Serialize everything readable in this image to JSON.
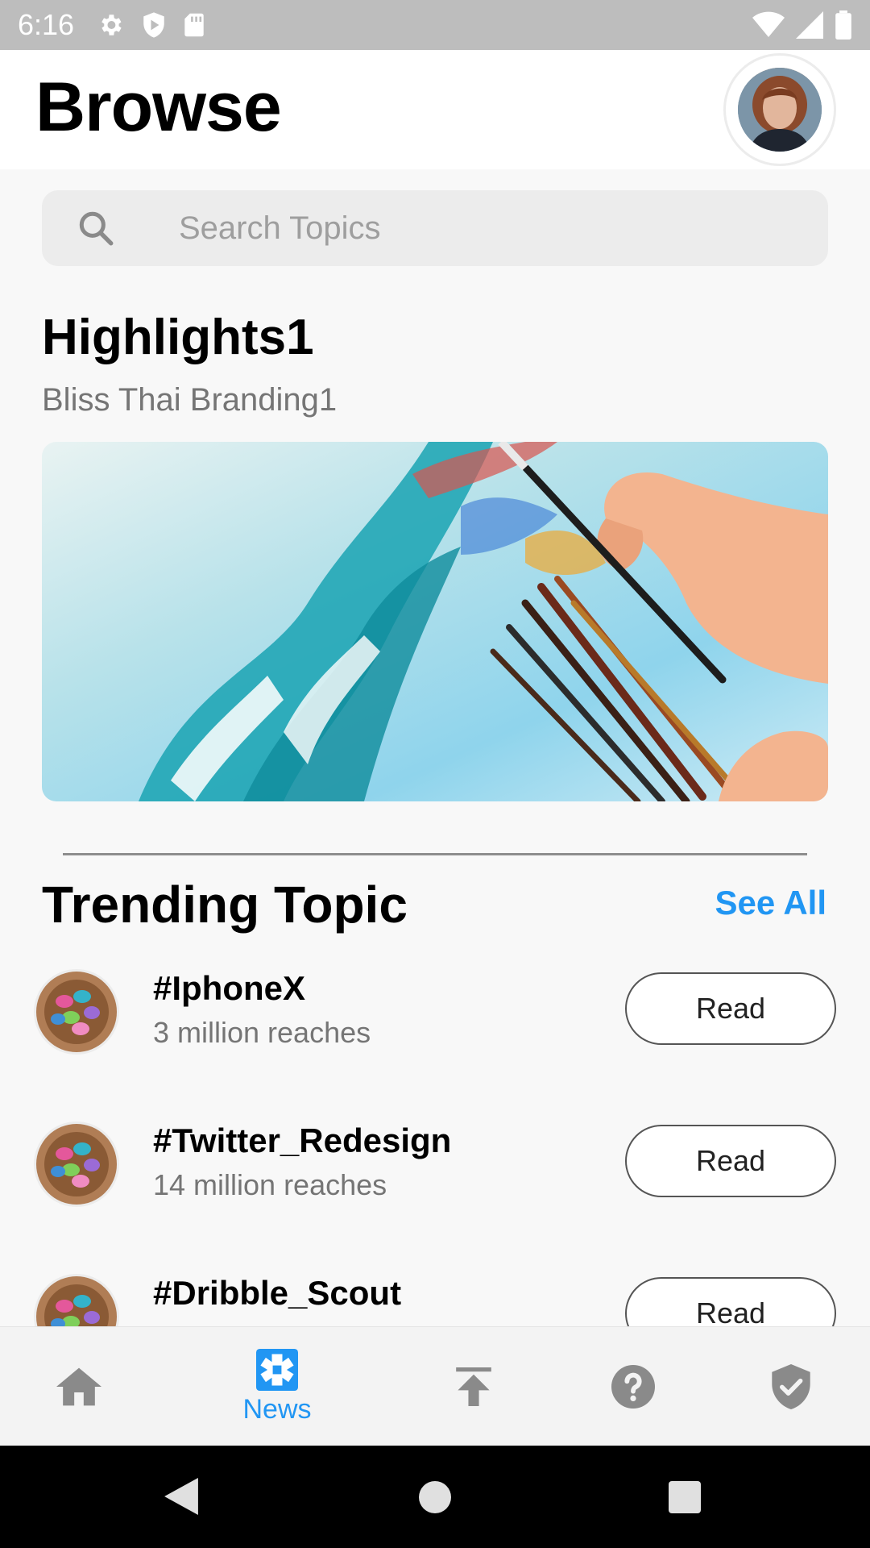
{
  "status_bar": {
    "time": "6:16"
  },
  "header": {
    "title": "Browse"
  },
  "search": {
    "placeholder": "Search Topics"
  },
  "highlights": {
    "title": "Highlights1",
    "subtitle": "Bliss Thai Branding1"
  },
  "trending": {
    "title": "Trending Topic",
    "see_all": "See All",
    "topics": [
      {
        "name": "#IphoneX",
        "reach": "3 million reaches",
        "button": "Read"
      },
      {
        "name": "#Twitter_Redesign",
        "reach": "14 million reaches",
        "button": "Read"
      },
      {
        "name": "#Dribble_Scout",
        "reach": "",
        "button": "Read"
      }
    ]
  },
  "bottom_nav": {
    "items": [
      {
        "icon": "home-icon",
        "label": ""
      },
      {
        "icon": "news-icon",
        "label": "News"
      },
      {
        "icon": "upload-icon",
        "label": ""
      },
      {
        "icon": "help-icon",
        "label": ""
      },
      {
        "icon": "shield-check-icon",
        "label": ""
      }
    ],
    "active_color": "#2196f3",
    "inactive_color": "#8a8a8a"
  },
  "colors": {
    "accent": "#2196f3",
    "status_bar": "#bdbdbd"
  }
}
